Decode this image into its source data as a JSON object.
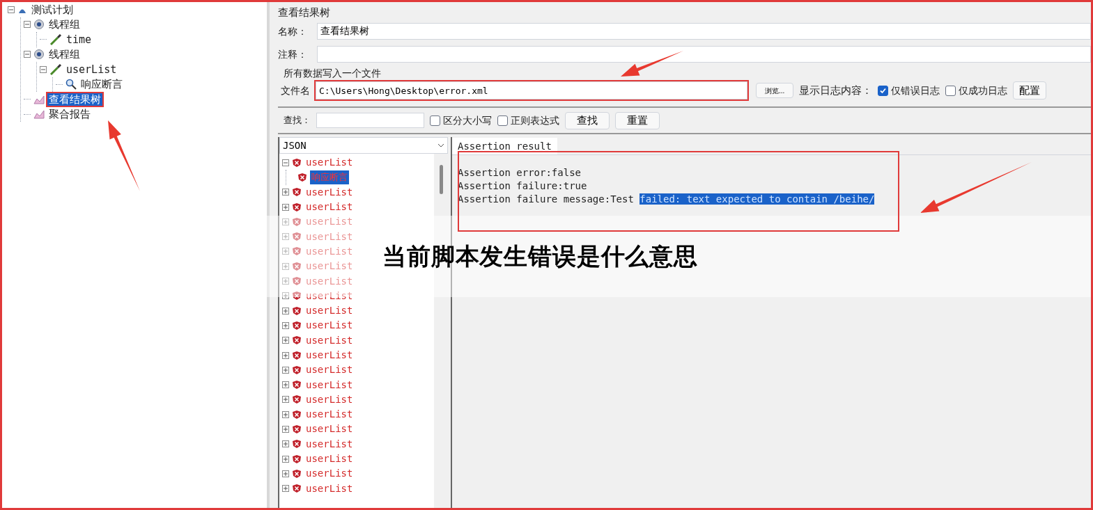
{
  "test_tree": [
    {
      "label": "测试计划",
      "kind": "plan",
      "selected": false,
      "children": [
        {
          "label": "线程组",
          "kind": "thread_group",
          "selected": false,
          "expanded": true,
          "children": [
            {
              "label": "time",
              "kind": "sampler",
              "selected": false
            }
          ]
        },
        {
          "label": "线程组",
          "kind": "thread_group",
          "selected": false,
          "expanded": true,
          "children": [
            {
              "label": "userList",
              "kind": "sampler",
              "selected": false,
              "expanded": true,
              "children": [
                {
                  "label": "响应断言",
                  "kind": "assertion",
                  "selected": false
                }
              ]
            }
          ]
        },
        {
          "label": "查看结果树",
          "kind": "listener",
          "selected": true
        },
        {
          "label": "聚合报告",
          "kind": "listener",
          "selected": false
        }
      ]
    }
  ],
  "panel": {
    "title": "查看结果树",
    "name_label": "名称：",
    "name_value": "查看结果树",
    "comment_label": "注释：",
    "file_section": "所有数据写入一个文件",
    "file_label": "文件名",
    "file_value": "C:\\Users\\Hong\\Desktop\\error.xml",
    "browse_button": "浏览...",
    "log_label": "显示日志内容：",
    "log_options": [
      {
        "label": "仅错误日志",
        "checked": true
      },
      {
        "label": "仅成功日志",
        "checked": false
      }
    ],
    "config_button": "配置",
    "search_label": "查找：",
    "search_options": [
      {
        "label": "区分大小写",
        "checked": false
      },
      {
        "label": "正则表达式",
        "checked": false
      }
    ],
    "search_buttons": [
      "查找",
      "重置"
    ],
    "renderer": "JSON",
    "results": [
      {
        "label": "userList",
        "expanded": true,
        "selected": false,
        "children": [
          {
            "label": "响应断言",
            "selected": true
          }
        ]
      },
      {
        "label": "userList",
        "expanded": false,
        "selected": false
      },
      {
        "label": "userList",
        "expanded": false,
        "selected": false
      },
      {
        "label": "userList",
        "expanded": false,
        "selected": false
      },
      {
        "label": "userList",
        "expanded": false,
        "selected": false
      },
      {
        "label": "userList",
        "expanded": false,
        "selected": false
      },
      {
        "label": "userList",
        "expanded": false,
        "selected": false
      },
      {
        "label": "userList",
        "expanded": false,
        "selected": false
      },
      {
        "label": "userList",
        "expanded": false,
        "selected": false
      },
      {
        "label": "userList",
        "expanded": false,
        "selected": false
      },
      {
        "label": "userList",
        "expanded": false,
        "selected": false
      },
      {
        "label": "userList",
        "expanded": false,
        "selected": false
      },
      {
        "label": "userList",
        "expanded": false,
        "selected": false
      },
      {
        "label": "userList",
        "expanded": false,
        "selected": false
      },
      {
        "label": "userList",
        "expanded": false,
        "selected": false
      },
      {
        "label": "userList",
        "expanded": false,
        "selected": false
      },
      {
        "label": "userList",
        "expanded": false,
        "selected": false
      },
      {
        "label": "userList",
        "expanded": false,
        "selected": false
      },
      {
        "label": "userList",
        "expanded": false,
        "selected": false
      },
      {
        "label": "userList",
        "expanded": false,
        "selected": false
      },
      {
        "label": "userList",
        "expanded": false,
        "selected": false
      },
      {
        "label": "userList",
        "expanded": false,
        "selected": false
      }
    ],
    "result_tab": "Assertion result",
    "result_lines": [
      {
        "text": "Assertion error:false"
      },
      {
        "text": "Assertion failure:true"
      },
      {
        "text": "Assertion failure message:Test ",
        "selected_text": "failed: text expected to contain /beihe/"
      }
    ]
  },
  "caption": "当前脚本发生错误是什么意思"
}
